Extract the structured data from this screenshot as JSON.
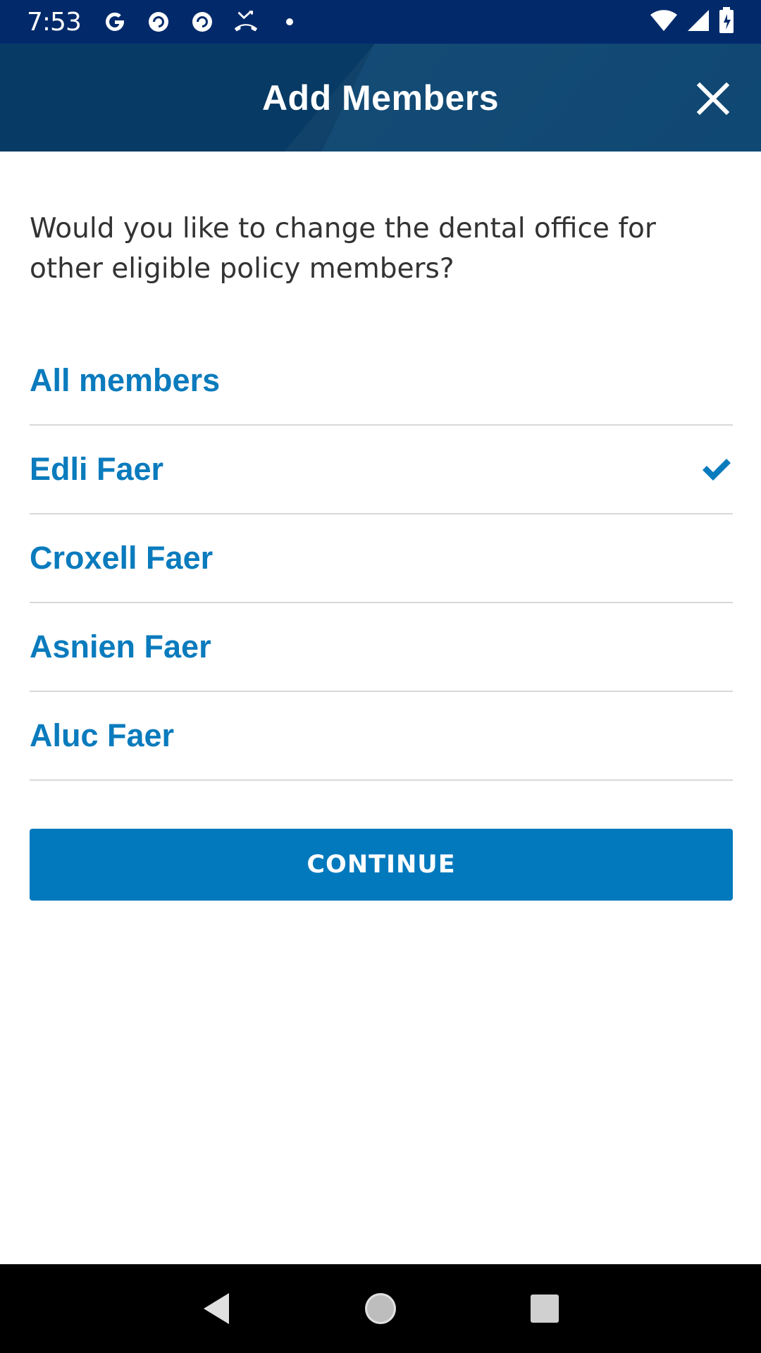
{
  "status_bar": {
    "time": "7:53",
    "left_icons": [
      "google-icon",
      "pocket-casts-icon",
      "pocket-casts-icon",
      "missed-call-icon",
      "dot-icon"
    ],
    "right_icons": [
      "wifi-icon",
      "cell-signal-icon",
      "battery-icon"
    ]
  },
  "header": {
    "title": "Add Members",
    "close_icon": "close-icon"
  },
  "prompt": "Would you like to change the dental office for other eligible policy members?",
  "members": [
    {
      "label": "All members",
      "selected": false
    },
    {
      "label": "Edli Faer",
      "selected": true
    },
    {
      "label": "Croxell Faer",
      "selected": false
    },
    {
      "label": "Asnien Faer",
      "selected": false
    },
    {
      "label": "Aluc Faer",
      "selected": false
    }
  ],
  "continue_label": "CONTINUE",
  "colors": {
    "status_bar": "#022a6b",
    "app_bar": "#073a64",
    "accent_blue": "#0a7bbd",
    "button_blue": "#0279bd",
    "prompt_text": "#333333",
    "divider": "#d8d8d8"
  },
  "nav_bar": {
    "buttons": [
      "back-icon",
      "home-icon",
      "recents-icon"
    ]
  }
}
